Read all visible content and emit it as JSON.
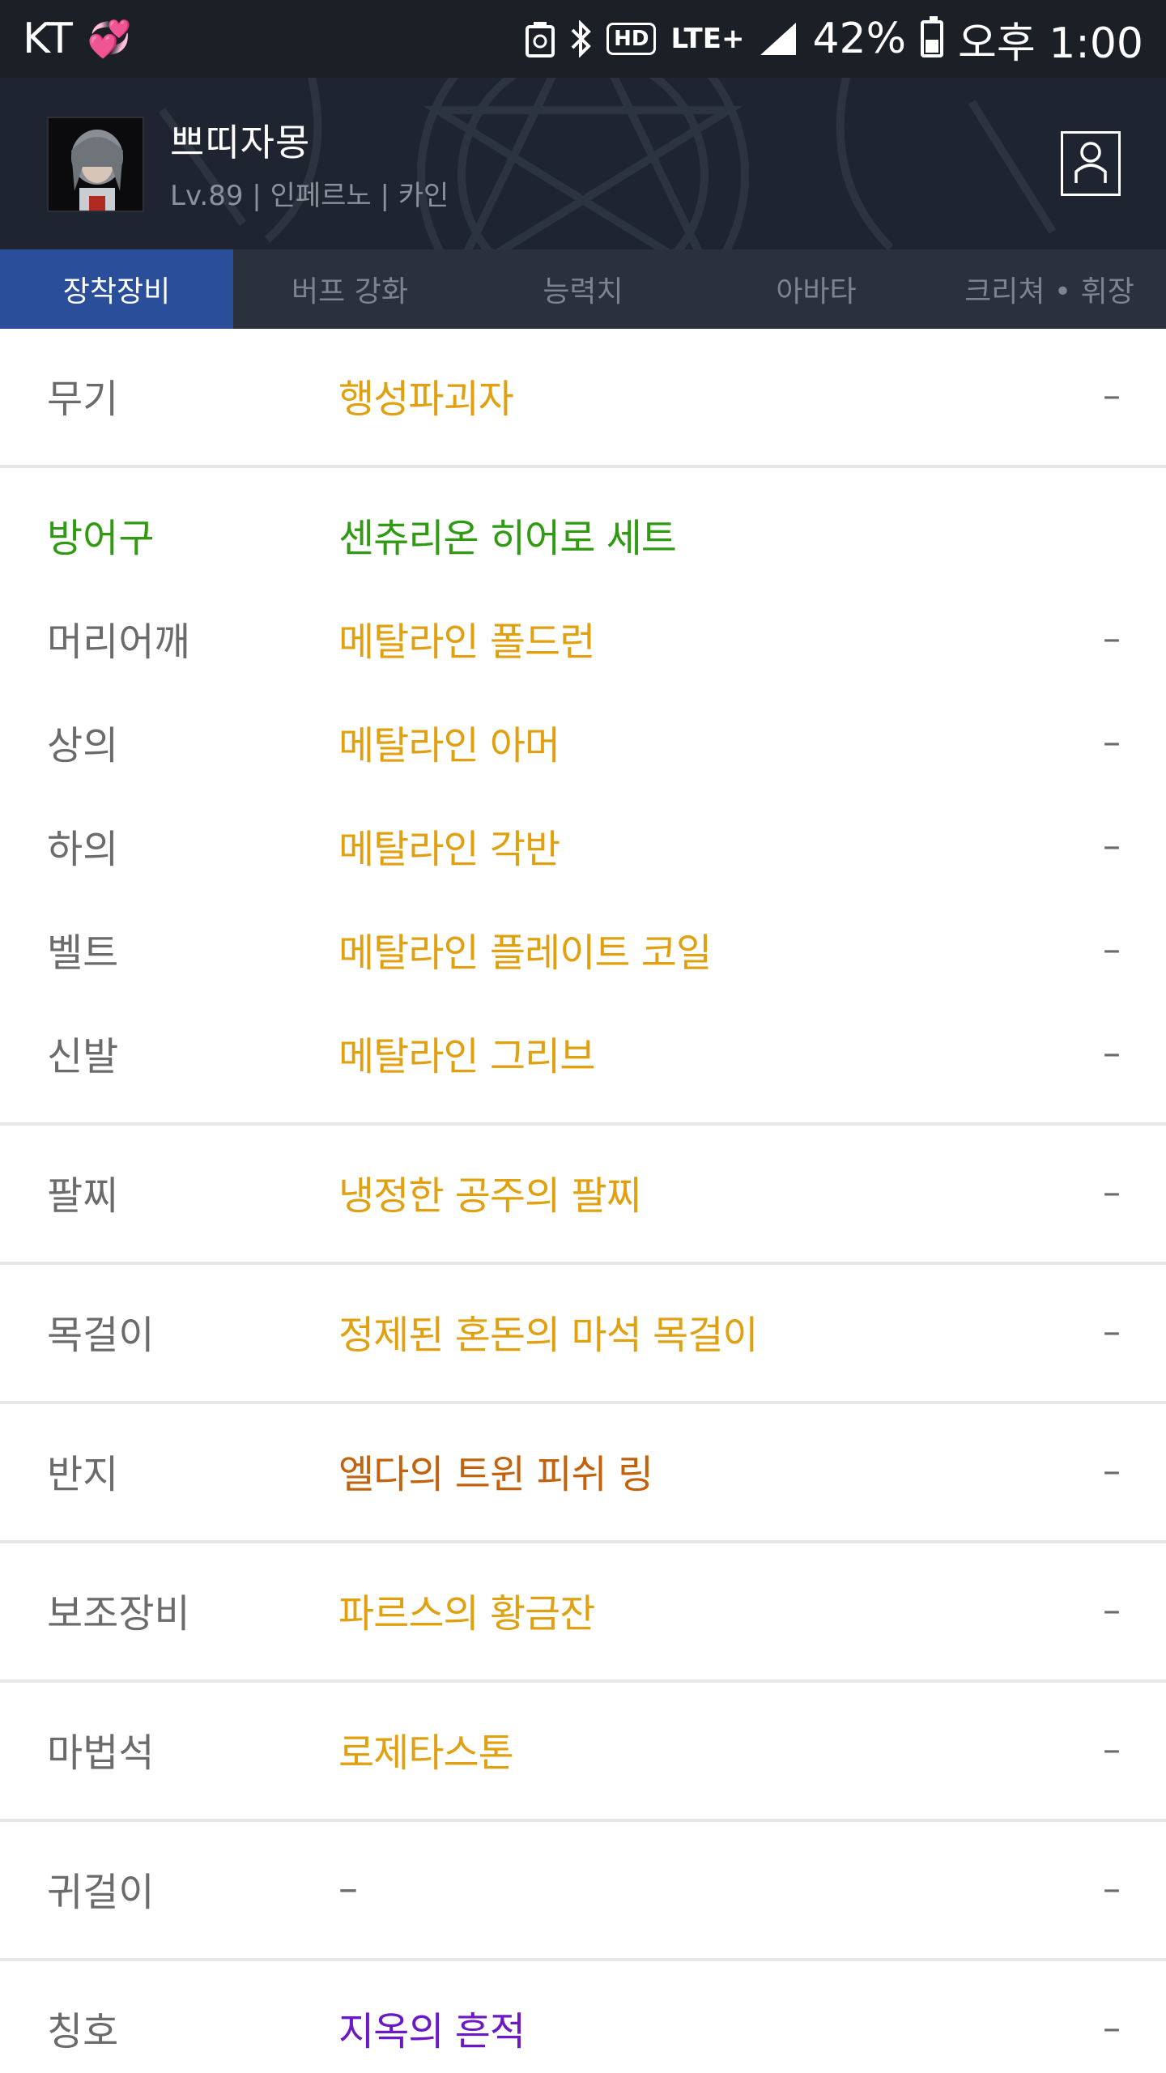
{
  "status_bar": {
    "carrier": "KT",
    "emoji": "💞",
    "network": "LTE+",
    "hd_label": "HD",
    "battery_percent": "42%",
    "time": "오후 1:00",
    "battery_level": 0.42
  },
  "profile": {
    "name": "쁘띠자몽",
    "info": "Lv.89 | 인페르노 | 카인"
  },
  "tabs": [
    {
      "label": "장착장비",
      "active": true
    },
    {
      "label": "버프 강화",
      "active": false
    },
    {
      "label": "능력치",
      "active": false
    },
    {
      "label": "아바타",
      "active": false
    },
    {
      "label": "크리쳐 • 휘장",
      "active": false
    }
  ],
  "equipment": [
    {
      "slot": "무기",
      "item": "행성파괴자",
      "extra": "–"
    },
    {
      "slot": "방어구",
      "item": "센츄리온 히어로 세트",
      "extra": ""
    },
    {
      "slot": "머리어깨",
      "item": "메탈라인 폴드런",
      "extra": "–"
    },
    {
      "slot": "상의",
      "item": "메탈라인 아머",
      "extra": "–"
    },
    {
      "slot": "하의",
      "item": "메탈라인 각반",
      "extra": "–"
    },
    {
      "slot": "벨트",
      "item": "메탈라인 플레이트 코일",
      "extra": "–"
    },
    {
      "slot": "신발",
      "item": "메탈라인 그리브",
      "extra": "–"
    },
    {
      "slot": "팔찌",
      "item": "냉정한 공주의 팔찌",
      "extra": "–"
    },
    {
      "slot": "목걸이",
      "item": "정제된 혼돈의 마석 목걸이",
      "extra": "–"
    },
    {
      "slot": "반지",
      "item": "엘다의 트윈 피쉬 링",
      "extra": "–"
    },
    {
      "slot": "보조장비",
      "item": "파르스의 황금잔",
      "extra": "–"
    },
    {
      "slot": "마법석",
      "item": "로제타스톤",
      "extra": "–"
    },
    {
      "slot": "귀걸이",
      "item": "–",
      "extra": "–"
    },
    {
      "slot": "칭호",
      "item": "지옥의 흔적",
      "extra": "–"
    }
  ],
  "colors": {
    "epic_gold": "#e0a010",
    "set_green": "#2f9a12",
    "legendary_brown": "#c2620c",
    "title_purple": "#6a19c4",
    "tab_active": "#2a4e9a"
  }
}
